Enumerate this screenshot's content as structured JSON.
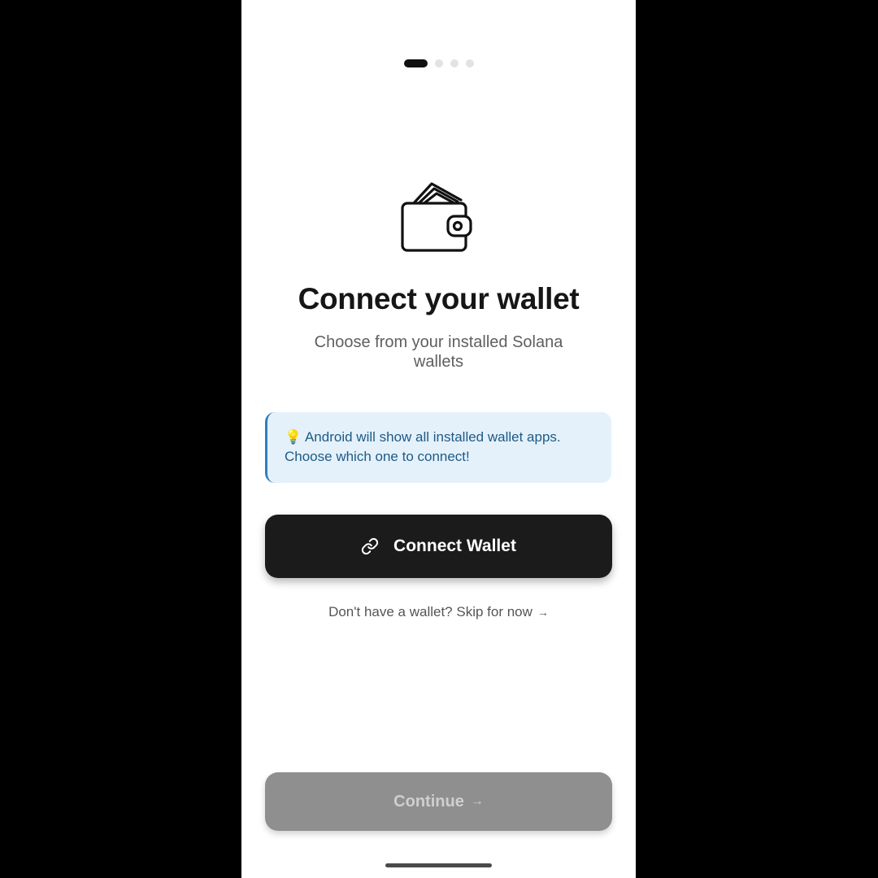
{
  "onboarding": {
    "total_steps": 4,
    "current_step": 1
  },
  "header": {
    "title": "Connect your wallet",
    "subtitle": "Choose from your installed Solana wallets"
  },
  "info": {
    "emoji": "💡",
    "text": "Android will show all installed wallet apps. Choose which one to connect!"
  },
  "connect_button": {
    "label": "Connect Wallet",
    "icon": "link-icon"
  },
  "skip": {
    "label": "Don't have a wallet? Skip for now",
    "arrow": "→"
  },
  "continue_button": {
    "label": "Continue",
    "arrow": "→",
    "state": "disabled"
  },
  "colors": {
    "primary_button": "#1b1b1b",
    "disabled_button": "#8f8f8f",
    "info_background": "#e4f1fb",
    "info_accent": "#2b7fc4"
  }
}
